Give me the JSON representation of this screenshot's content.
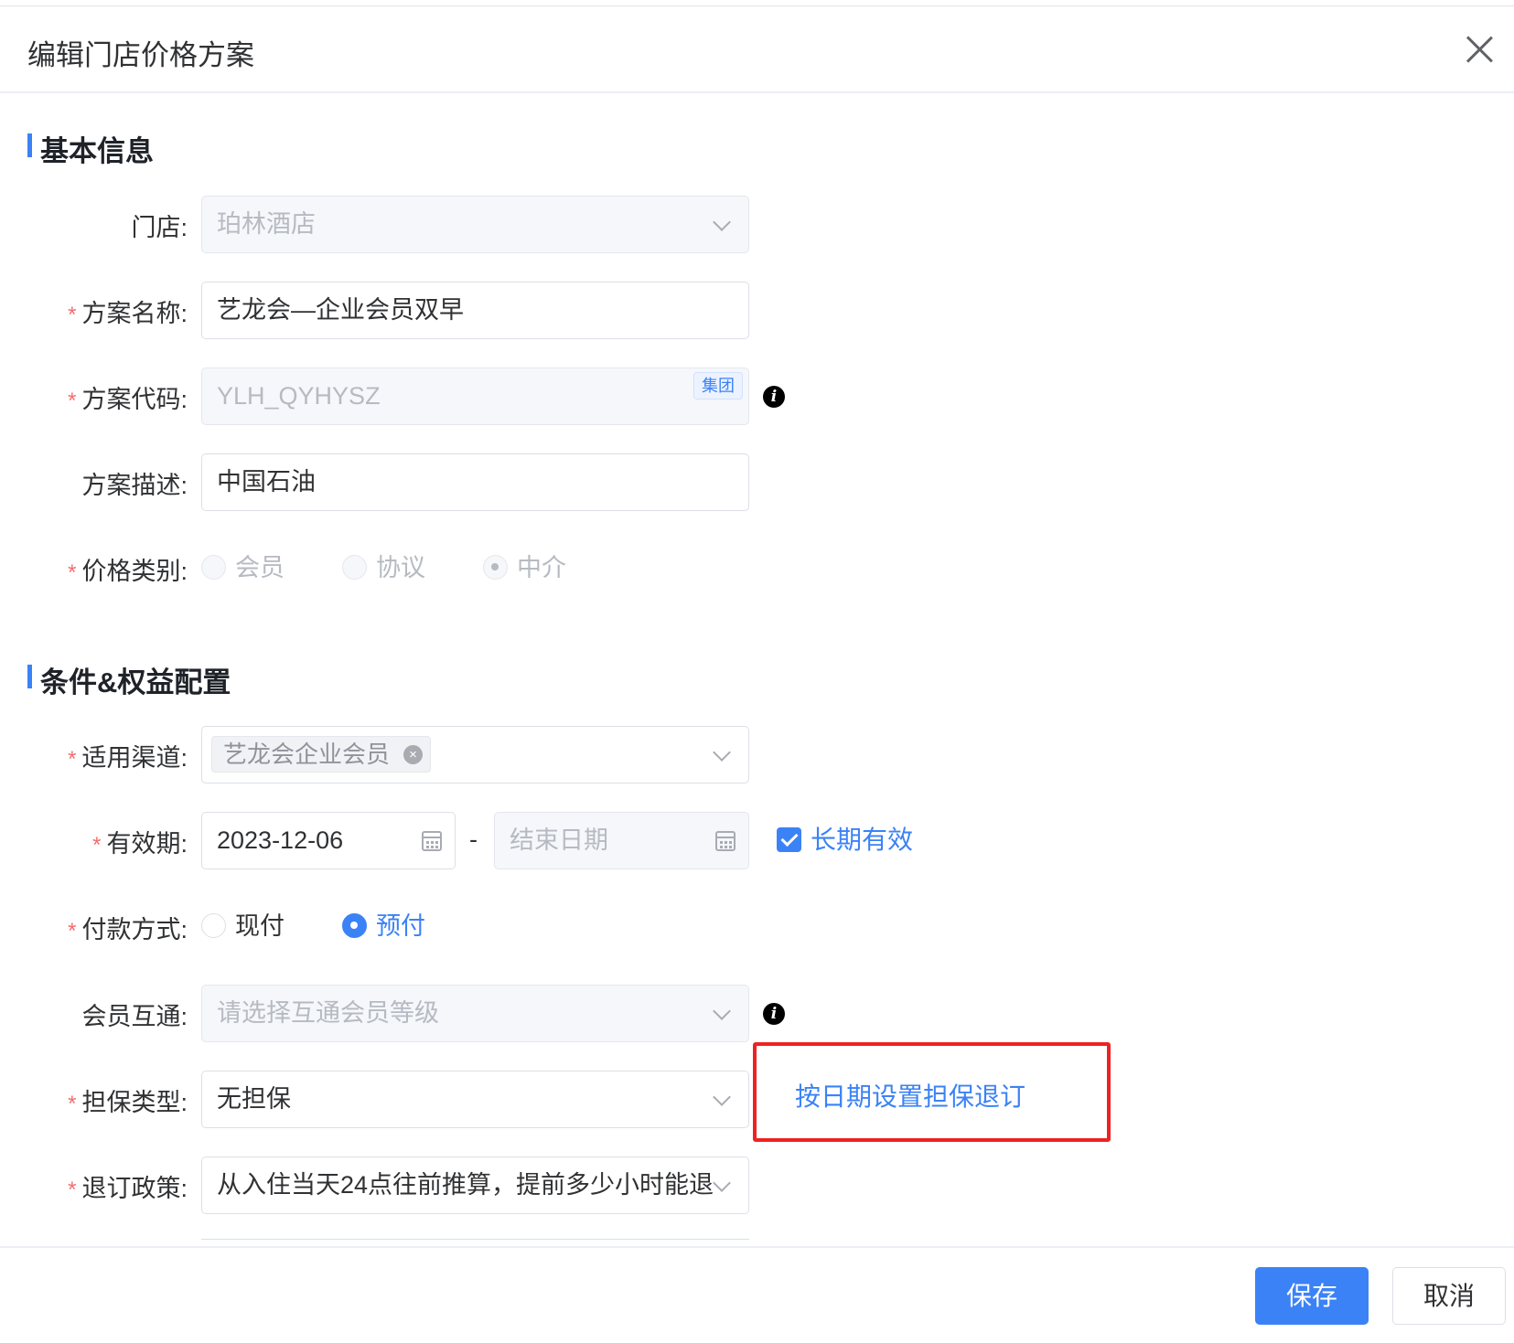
{
  "dialog": {
    "title": "编辑门店价格方案"
  },
  "sections": {
    "basic": "基本信息",
    "conditions": "条件&权益配置"
  },
  "form": {
    "store": {
      "label": "门店:",
      "value": "珀林酒店"
    },
    "plan_name": {
      "label": "方案名称:",
      "value": "艺龙会—企业会员双早"
    },
    "plan_code": {
      "label": "方案代码:",
      "value": "YLH_QYHYSZ",
      "tag": "集团"
    },
    "plan_desc": {
      "label": "方案描述:",
      "value": "中国石油"
    },
    "price_type": {
      "label": "价格类别:",
      "options": [
        "会员",
        "协议",
        "中介"
      ],
      "selected": "中介"
    },
    "channel": {
      "label": "适用渠道:",
      "chip": "艺龙会企业会员"
    },
    "validity": {
      "label": "有效期:",
      "start": "2023-12-06",
      "separator": "-",
      "end_placeholder": "结束日期",
      "long_term_label": "长期有效",
      "long_term_checked": true
    },
    "payment": {
      "label": "付款方式:",
      "options": [
        "现付",
        "预付"
      ],
      "selected": "预付"
    },
    "member_interop": {
      "label": "会员互通:",
      "placeholder": "请选择互通会员等级"
    },
    "guarantee": {
      "label": "担保类型:",
      "value": "无担保",
      "date_link": "按日期设置担保退订"
    },
    "cancel_policy": {
      "label": "退订政策:",
      "value": "从入住当天24点往前推算，提前多少小时能退"
    }
  },
  "footer": {
    "save": "保存",
    "cancel": "取消"
  },
  "required_mark": "*",
  "colors": {
    "accent": "#3b82f6",
    "required": "#f56c6c",
    "highlight": "#ee2222"
  },
  "icons": {
    "close": "close-icon",
    "chevron": "chevron-down-icon",
    "info": "info-icon",
    "calendar": "calendar-icon",
    "chip_remove": "remove-icon"
  }
}
